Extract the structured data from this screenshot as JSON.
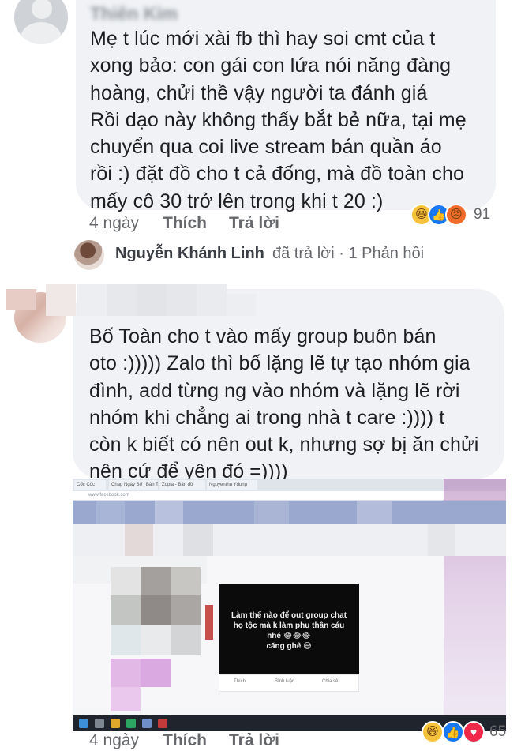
{
  "comment1": {
    "author": "Thiên Kim",
    "lines": [
      "Mẹ t lúc mới xài fb thì hay soi cmt của t",
      "xong bảo: con gái con lứa nói năng đàng",
      "hoàng, chửi thề vậy người ta đánh giá",
      "Rồi dạo này không thấy bắt bẻ nữa, tại mẹ",
      "chuyển qua coi live stream bán quần áo",
      "rồi :) đặt đồ cho t cả đống, mà đồ toàn cho",
      "mấy cô 30 trở lên trong khi t 20 :)"
    ],
    "time": "4 ngày",
    "like_label": "Thích",
    "reply_label": "Trả lời",
    "reaction_count": "91",
    "reactions": [
      "haha-icon",
      "like-icon",
      "angry-icon"
    ]
  },
  "reply_summary": {
    "name": "Nguyễn Khánh Linh",
    "meta": "đã trả lời · 1 Phản hồi"
  },
  "comment2": {
    "lines": [
      "Bố Toàn cho t vào mấy group buôn bán",
      "oto :))))) Zalo thì bố lặng lẽ tự tạo nhóm gia",
      "đình, add từng ng vào nhóm và lặng lẽ rời",
      "nhóm khi chẳng ai trong nhà t care :)))) t",
      "còn k biết có nên out k, nhưng sợ bị ăn chửi",
      "nên cứ để yên đó =))))"
    ],
    "screenshot": {
      "tabs": [
        "Cốc Cốc",
        "Chap Ngày Bố | Bản T",
        "Zopia - Bản đồ",
        "Nguyenthu Ydung"
      ],
      "address": "www.facebook.com",
      "post_text": "Làm thế nào để out group chat\nhọ tộc mà k làm phụ thân cáu\nnhé 😂😂😂\ncăng ghê 😅",
      "post_actions": [
        "Thích",
        "Bình luận",
        "Chia sẻ"
      ]
    },
    "time": "4 ngày",
    "like_label": "Thích",
    "reply_label": "Trả lời",
    "reaction_count": "65",
    "reactions": [
      "haha-icon",
      "like-icon",
      "love-icon"
    ]
  },
  "colors": {
    "bubble": "#f0f2f5",
    "meta_text": "#65676b",
    "like_blue": "#1877f2",
    "haha_yellow": "#f7c33b",
    "angry_orange": "#f16c2a",
    "love_red": "#f0284a"
  }
}
